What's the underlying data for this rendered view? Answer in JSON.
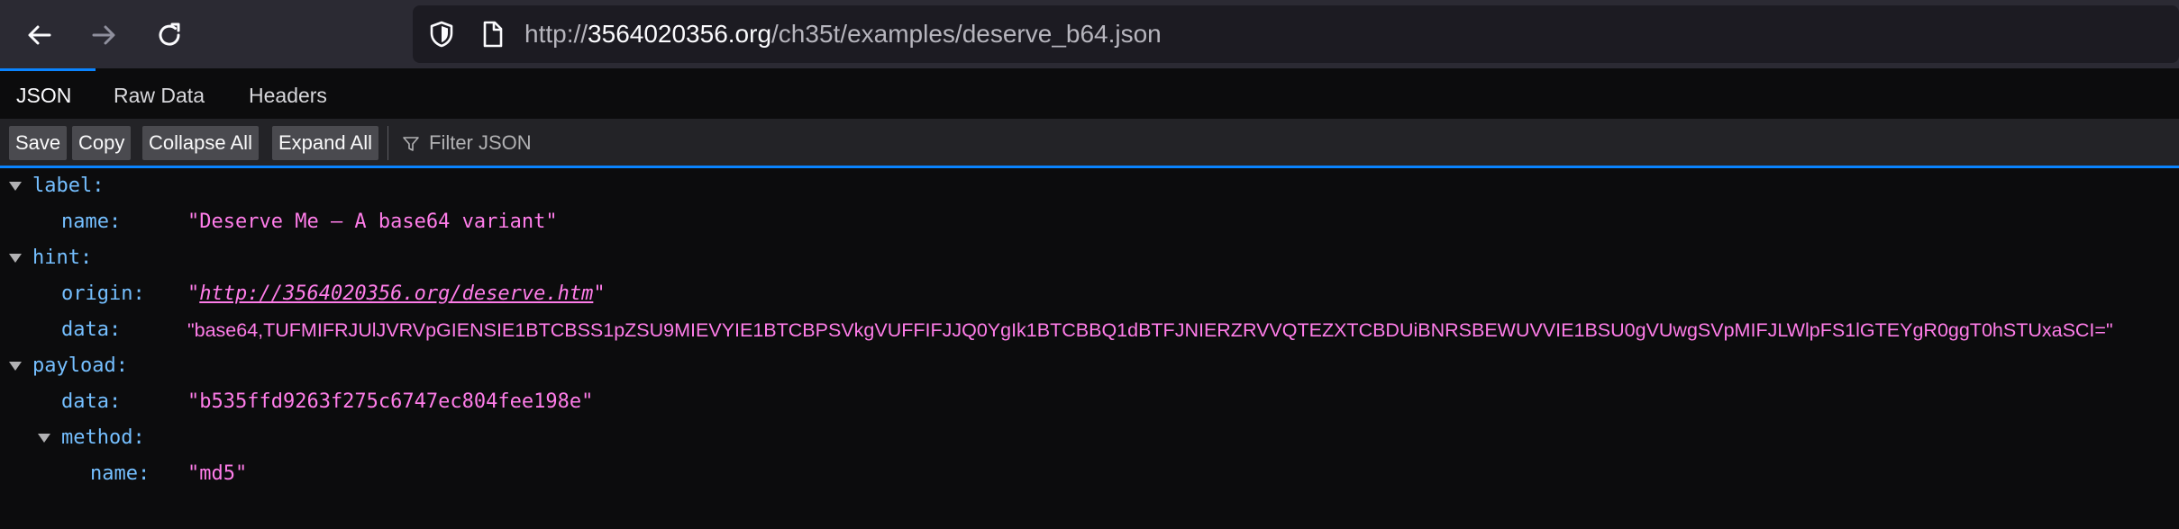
{
  "navigation": {
    "back_icon": "arrow-left-icon",
    "forward_icon": "arrow-right-icon",
    "reload_icon": "reload-icon",
    "shield_icon": "shield-icon",
    "page_icon": "page-icon"
  },
  "url": {
    "scheme": "http://",
    "host": "3564020356.org",
    "path": "/ch35t/examples/deserve_b64.json"
  },
  "tabs": [
    {
      "label": "JSON",
      "active": true
    },
    {
      "label": "Raw Data",
      "active": false
    },
    {
      "label": "Headers",
      "active": false
    }
  ],
  "toolbar": {
    "save_label": "Save",
    "copy_label": "Copy",
    "collapse_label": "Collapse All",
    "expand_label": "Expand All",
    "filter_placeholder": "Filter JSON",
    "filter_icon": "filter-icon"
  },
  "tree": {
    "label_key": "label:",
    "label_name_key": "name:",
    "label_name_value": "\"Deserve Me – A base64 variant\"",
    "hint_key": "hint:",
    "hint_origin_key": "origin:",
    "hint_origin_quote_open": "\"",
    "hint_origin_link": "http://3564020356.org/deserve.htm",
    "hint_origin_quote_close": "\"",
    "hint_data_key": "data:",
    "hint_data_value": "\"base64,TUFMIFRJUlJVRVpGIENSIE1BTCBSS1pZSU9MIEVYIE1BTCBPSVkgVUFFIFJJQ0YgIk1BTCBBQ1dBTFJNIERZRVVQTEZXTCBDUiBNRSBEWUVVIE1BSU0gVUwgSVpMIFJLWlpFS1lGTEYgR0ggT0hSTUxaSCI=\"",
    "payload_key": "payload:",
    "payload_data_key": "data:",
    "payload_data_value": "\"b535ffd9263f275c6747ec804fee198e\"",
    "method_key": "method:",
    "method_name_key": "name:",
    "method_name_value": "\"md5\""
  },
  "colors": {
    "key": "#75bfff",
    "string": "#ff7de9",
    "accent": "#0a84ff"
  }
}
